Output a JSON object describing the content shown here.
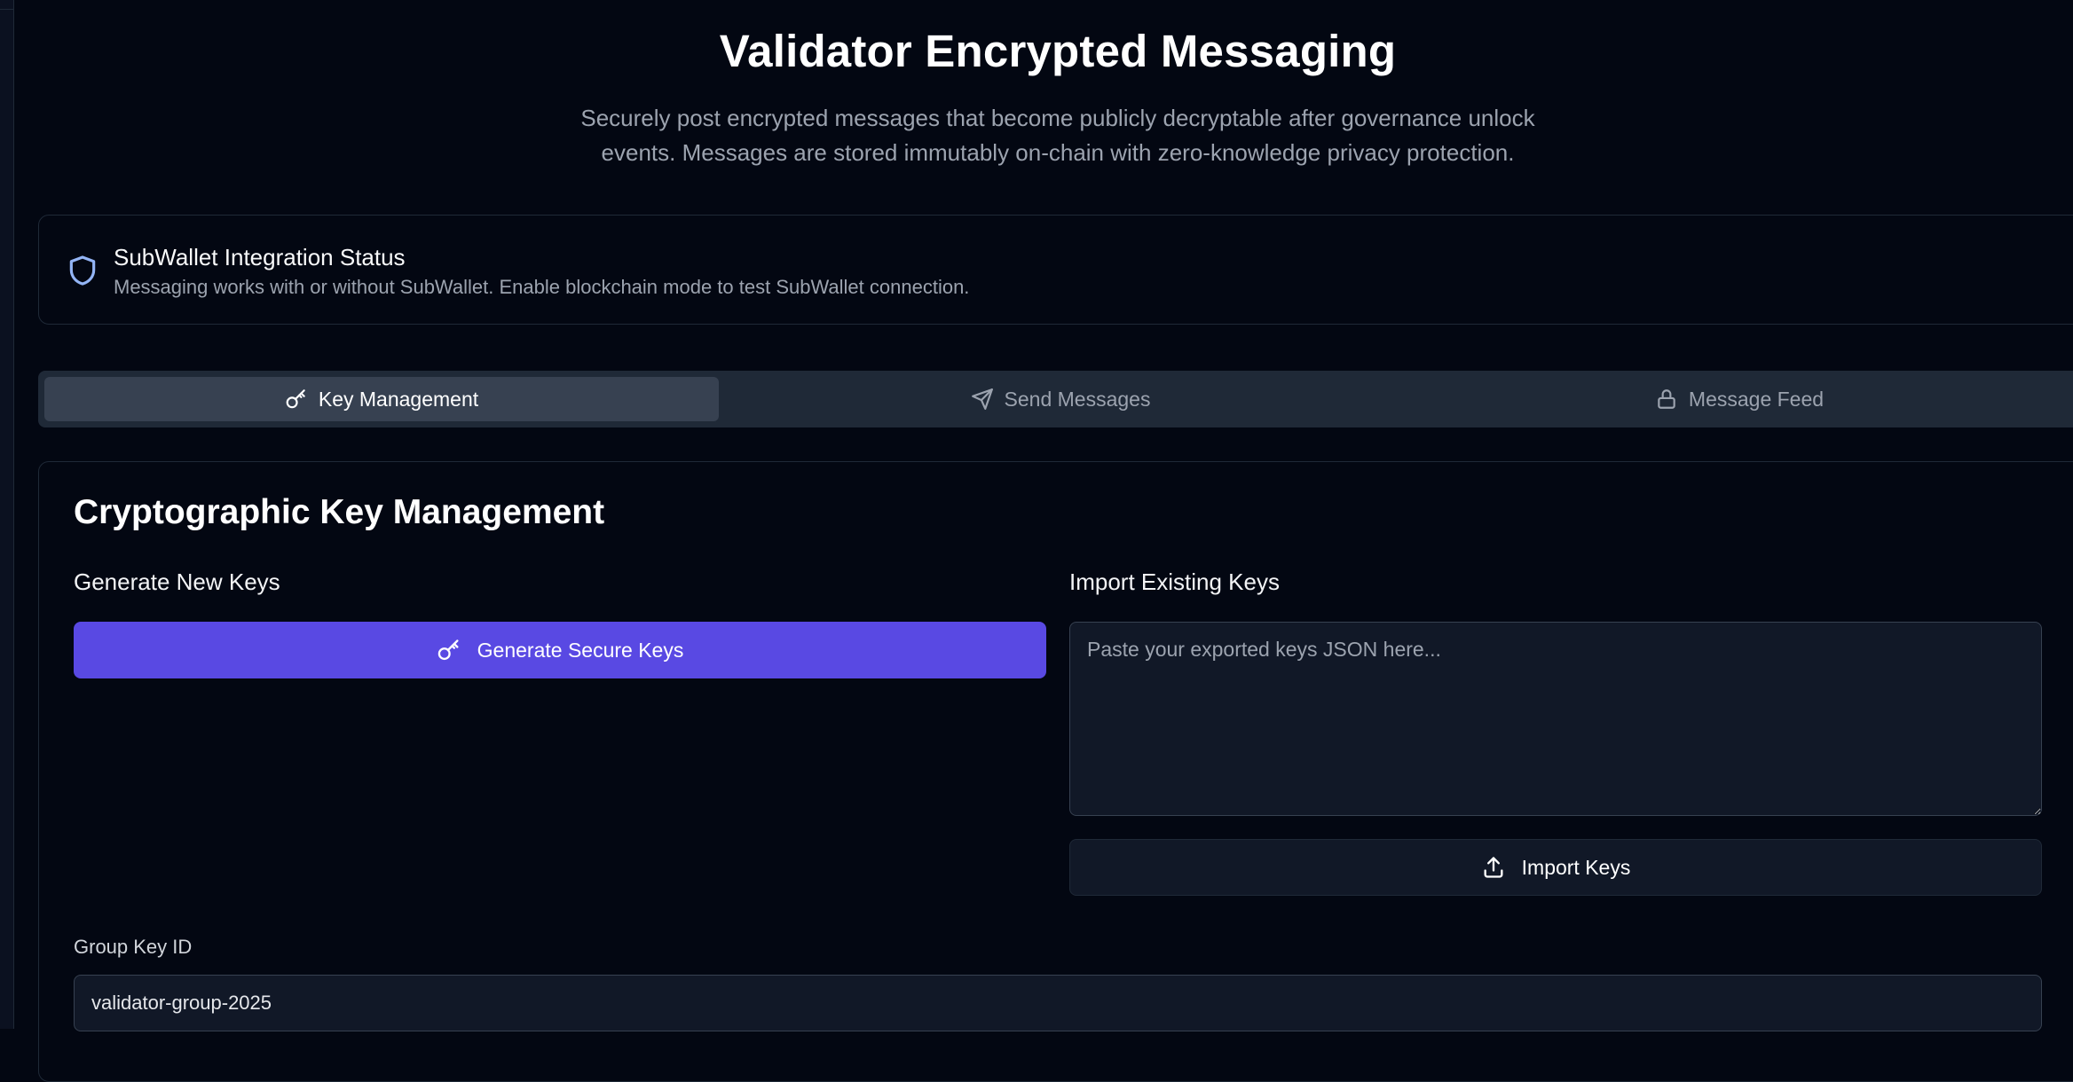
{
  "header": {
    "title": "Validator Encrypted Messaging",
    "subtitle": "Securely post encrypted messages that become publicly decryptable after governance unlock events. Messages are stored immutably on-chain with zero-knowledge privacy protection."
  },
  "status": {
    "icon": "shield-icon",
    "title": "SubWallet Integration Status",
    "description": "Messaging works with or without SubWallet. Enable blockchain mode to test SubWallet connection."
  },
  "tabs": [
    {
      "label": "Key Management",
      "icon": "key-icon",
      "active": true
    },
    {
      "label": "Send Messages",
      "icon": "send-icon",
      "active": false
    },
    {
      "label": "Message Feed",
      "icon": "lock-icon",
      "active": false
    }
  ],
  "panel": {
    "title": "Cryptographic Key Management",
    "generate": {
      "section_label": "Generate New Keys",
      "button_label": "Generate Secure Keys"
    },
    "import": {
      "section_label": "Import Existing Keys",
      "placeholder": "Paste your exported keys JSON here...",
      "value": "",
      "button_label": "Import Keys"
    },
    "group_key": {
      "label": "Group Key ID",
      "value": "validator-group-2025"
    }
  },
  "colors": {
    "background": "#030712",
    "accent": "#5949e3",
    "icon_accent": "#93b4f5",
    "muted_text": "#9ca3af"
  }
}
